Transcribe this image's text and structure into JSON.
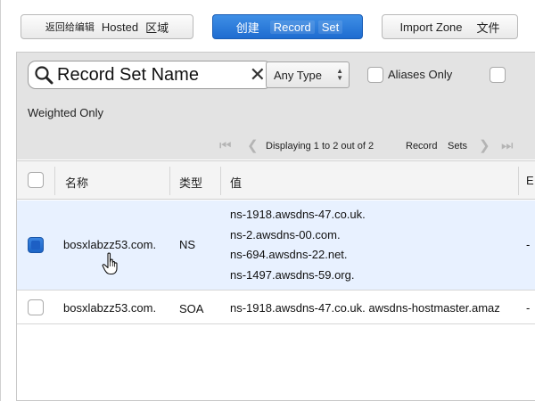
{
  "toolbar": {
    "back_button": {
      "seg1": "返回给编辑",
      "seg2": "Hosted",
      "seg3": "区域"
    },
    "create_button": {
      "seg1": "创建",
      "seg2": "Record",
      "seg3": "Set"
    },
    "import_button": {
      "seg1": "Import Zone",
      "seg2": "文件"
    }
  },
  "filters": {
    "search": {
      "placeholder": "Record Set Name",
      "value": ""
    },
    "type_select": "Any Type",
    "aliases_only_label": "Aliases Only",
    "weighted_only_label": "Weighted Only"
  },
  "pager": {
    "text": "Displaying 1 to 2 out of 2",
    "record_label": "Record",
    "sets_label": "Sets"
  },
  "table": {
    "headers": {
      "name": "名称",
      "type": "类型",
      "value": "值",
      "extra": "E"
    },
    "rows": [
      {
        "name": "bosxlabzz53.com.",
        "type": "NS",
        "values": [
          "ns-1918.awsdns-47.co.uk.",
          "ns-2.awsdns-00.com.",
          "ns-694.awsdns-22.net.",
          "ns-1497.awsdns-59.org."
        ],
        "extra": "-",
        "selected": true
      },
      {
        "name": "bosxlabzz53.com.",
        "type": "SOA",
        "values": [
          "ns-1918.awsdns-47.co.uk. awsdns-hostmaster.amaz"
        ],
        "extra": "-",
        "selected": false
      }
    ]
  },
  "colors": {
    "primary": "#1e6cd0",
    "selected_row": "#e8f1ff",
    "filter_bg": "#e3e3e3"
  },
  "icons": [
    "search-icon",
    "clear-icon",
    "first-page-icon",
    "prev-page-icon",
    "next-page-icon",
    "last-page-icon",
    "hand-cursor-icon"
  ]
}
